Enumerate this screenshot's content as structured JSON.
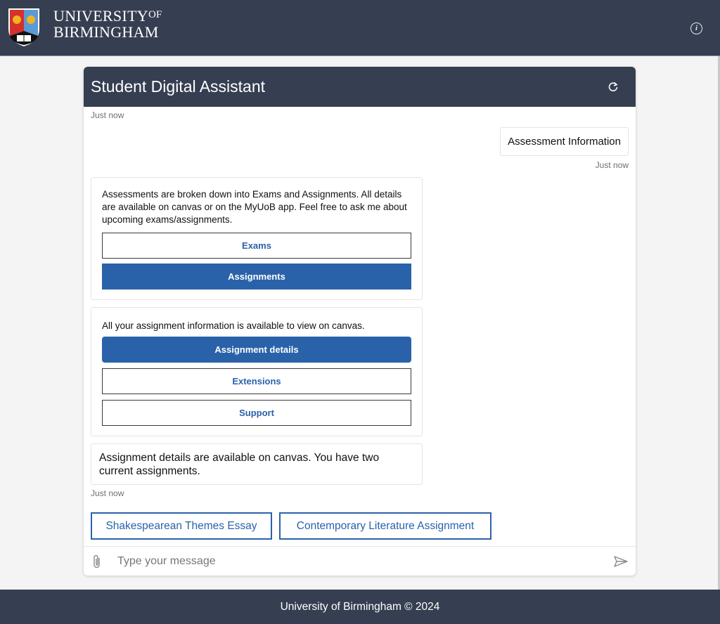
{
  "header": {
    "brand_line1": "UNIVERSITY",
    "brand_of": "OF",
    "brand_line2": "BIRMINGHAM",
    "info_icon": "info-icon"
  },
  "chat": {
    "title": "Student Digital Assistant",
    "refresh_icon": "refresh-icon",
    "messages": [
      {
        "type": "timestamp",
        "text": "Just now"
      },
      {
        "type": "user",
        "text": "Assessment Information",
        "timestamp": "Just now"
      },
      {
        "type": "bot-card",
        "text": "Assessments are broken down into Exams and Assignments. All details are available on canvas or on the MyUoB app. Feel free to ask me about upcoming exams/assignments.",
        "options": [
          {
            "label": "Exams",
            "style": "outline"
          },
          {
            "label": "Assignments",
            "style": "filled"
          }
        ]
      },
      {
        "type": "bot-card",
        "text": "All your assignment information is available to view on canvas.",
        "options": [
          {
            "label": "Assignment details",
            "style": "filled"
          },
          {
            "label": "Extensions",
            "style": "outline"
          },
          {
            "label": "Support",
            "style": "outline"
          }
        ]
      },
      {
        "type": "bot",
        "text": "Assignment details are available on canvas. You have two current assignments.",
        "timestamp": "Just now"
      }
    ],
    "quick_replies": [
      "Shakespearean Themes Essay",
      "Contemporary Literature Assignment"
    ],
    "composer": {
      "placeholder": "Type your message",
      "value": "",
      "attach_icon": "paperclip-icon",
      "send_icon": "send-icon"
    }
  },
  "footer": {
    "text": "University of Birmingham © 2024"
  },
  "colors": {
    "header_bg": "#363f51",
    "accent": "#2a62aa",
    "page_bg": "#f4f4f4"
  }
}
